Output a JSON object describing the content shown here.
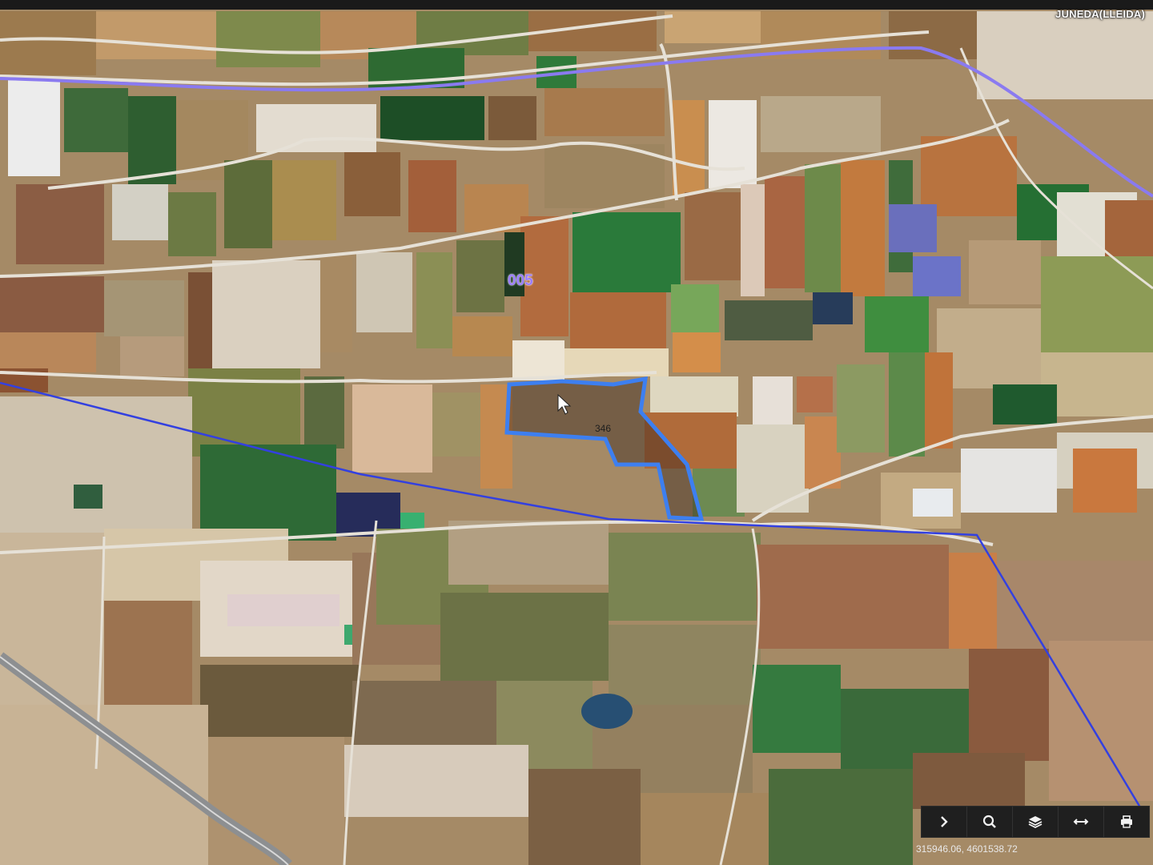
{
  "map": {
    "municipality": "JUNEDA(LLEIDA)",
    "polygon_label": "005",
    "parcel_label": "346",
    "coordinates": "315946.06, 4601538.72",
    "boundary_color": "#3340e0",
    "road_line_color": "#8a7af0",
    "selected_parcel_color": "#3d7ff0"
  },
  "toolbar": {
    "buttons": [
      {
        "icon": "chevron-right-icon",
        "label": "expand"
      },
      {
        "icon": "search-icon",
        "label": "search"
      },
      {
        "icon": "layers-icon",
        "label": "layers"
      },
      {
        "icon": "measure-icon",
        "label": "measure"
      },
      {
        "icon": "print-icon",
        "label": "print"
      }
    ]
  }
}
